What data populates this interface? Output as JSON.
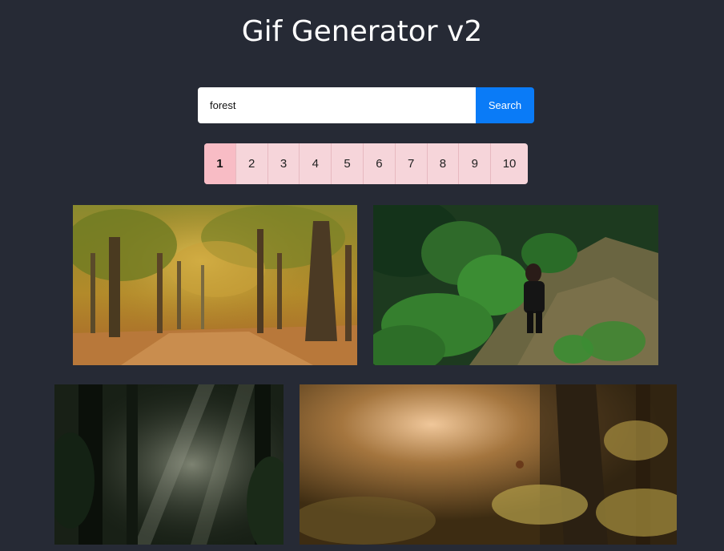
{
  "header": {
    "title": "Gif Generator v2"
  },
  "search": {
    "value": "forest",
    "button_label": "Search"
  },
  "pagination": {
    "pages": [
      "1",
      "2",
      "3",
      "4",
      "5",
      "6",
      "7",
      "8",
      "9",
      "10"
    ],
    "active": "1"
  },
  "results": [
    {
      "name": "autumn-forest-path-gif",
      "icon": "gif-image"
    },
    {
      "name": "woman-in-forest-clearing-gif",
      "icon": "gif-image"
    },
    {
      "name": "misty-dark-forest-gif",
      "icon": "gif-image"
    },
    {
      "name": "golden-light-forest-gif",
      "icon": "gif-image"
    }
  ],
  "colors": {
    "background": "#262a35",
    "search_button": "#0a7bf7",
    "pagination_bg": "#f6d5da",
    "pagination_active": "#f8bcc5"
  }
}
